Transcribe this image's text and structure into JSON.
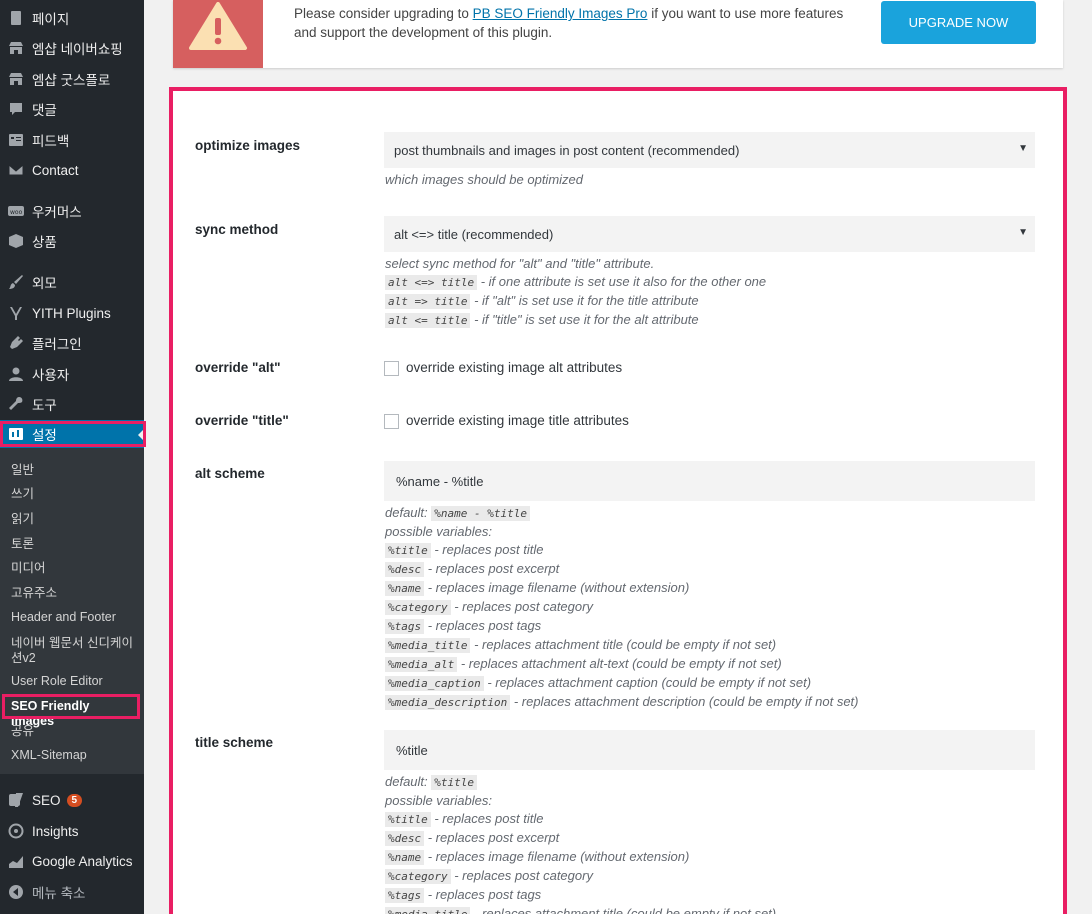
{
  "sidebar": {
    "items": [
      {
        "label": "페이지",
        "icon": "pages-icon"
      },
      {
        "label": "엠샵 네이버쇼핑",
        "icon": "store-icon"
      },
      {
        "label": "엠샵 굿스플로",
        "icon": "store-icon"
      },
      {
        "label": "댓글",
        "icon": "comment-icon"
      },
      {
        "label": "피드백",
        "icon": "feedback-icon"
      },
      {
        "label": "Contact",
        "icon": "mail-icon"
      },
      {
        "label": "우커머스",
        "icon": "woocommerce-icon"
      },
      {
        "label": "상품",
        "icon": "archive-icon"
      },
      {
        "label": "외모",
        "icon": "paintbrush-icon"
      },
      {
        "label": "YITH Plugins",
        "icon": "yith-icon"
      },
      {
        "label": "플러그인",
        "icon": "plugin-icon"
      },
      {
        "label": "사용자",
        "icon": "users-icon"
      },
      {
        "label": "도구",
        "icon": "wrench-icon"
      },
      {
        "label": "설정",
        "icon": "settings-icon"
      }
    ],
    "submenu": [
      "일반",
      "쓰기",
      "읽기",
      "토론",
      "미디어",
      "고유주소",
      "Header and Footer",
      "네이버 웹문서 신디케이션v2",
      "User Role Editor",
      "SEO Friendly Images",
      "공유",
      "XML-Sitemap"
    ],
    "bottom": [
      {
        "label": "SEO",
        "icon": "yoast-icon",
        "badge": "5"
      },
      {
        "label": "Insights",
        "icon": "insights-icon"
      },
      {
        "label": "Google Analytics",
        "icon": "analytics-icon"
      },
      {
        "label": "메뉴 축소",
        "icon": "collapse-icon"
      }
    ]
  },
  "notice": {
    "text_before": "Please consider upgrading to ",
    "link": "PB SEO Friendly Images Pro",
    "text_after": " if you want to use more features and support the development of this plugin.",
    "button": "UPGRADE NOW"
  },
  "settings": {
    "optimize": {
      "label": "optimize images",
      "value": "post thumbnails and images in post content (recommended)",
      "desc": "which images should be optimized"
    },
    "sync": {
      "label": "sync method",
      "value": "alt <=> title (recommended)",
      "desc": "select sync method for \"alt\" and \"title\" attribute.",
      "options": [
        {
          "code": "alt <=> title",
          "text": " - if one attribute is set use it also for the other one"
        },
        {
          "code": "alt => title",
          "text": " - if \"alt\" is set use it for the title attribute"
        },
        {
          "code": "alt <= title",
          "text": " - if \"title\" is set use it for the alt attribute"
        }
      ]
    },
    "override_alt": {
      "label": "override \"alt\"",
      "checkbox": "override existing image alt attributes"
    },
    "override_title": {
      "label": "override \"title\"",
      "checkbox": "override existing image title attributes"
    },
    "alt_scheme": {
      "label": "alt scheme",
      "value": "%name - %title",
      "default_label": "default: ",
      "default_code": "%name - %title",
      "vars_label": "possible variables:",
      "vars": [
        {
          "code": "%title",
          "text": " - replaces post title"
        },
        {
          "code": "%desc",
          "text": " - replaces post excerpt"
        },
        {
          "code": "%name",
          "text": " - replaces image filename (without extension)"
        },
        {
          "code": "%category",
          "text": " - replaces post category"
        },
        {
          "code": "%tags",
          "text": " - replaces post tags"
        },
        {
          "code": "%media_title",
          "text": " - replaces attachment title (could be empty if not set)"
        },
        {
          "code": "%media_alt",
          "text": " - replaces attachment alt-text (could be empty if not set)"
        },
        {
          "code": "%media_caption",
          "text": " - replaces attachment caption (could be empty if not set)"
        },
        {
          "code": "%media_description",
          "text": " - replaces attachment description (could be empty if not set)"
        }
      ]
    },
    "title_scheme": {
      "label": "title scheme",
      "value": "%title",
      "default_label": "default: ",
      "default_code": "%title",
      "vars_label": "possible variables:",
      "vars": [
        {
          "code": "%title",
          "text": " - replaces post title"
        },
        {
          "code": "%desc",
          "text": " - replaces post excerpt"
        },
        {
          "code": "%name",
          "text": " - replaces image filename (without extension)"
        },
        {
          "code": "%category",
          "text": " - replaces post category"
        },
        {
          "code": "%tags",
          "text": " - replaces post tags"
        },
        {
          "code": "%media_title",
          "text": " - replaces attachment title (could be empty if not set)"
        }
      ]
    }
  }
}
